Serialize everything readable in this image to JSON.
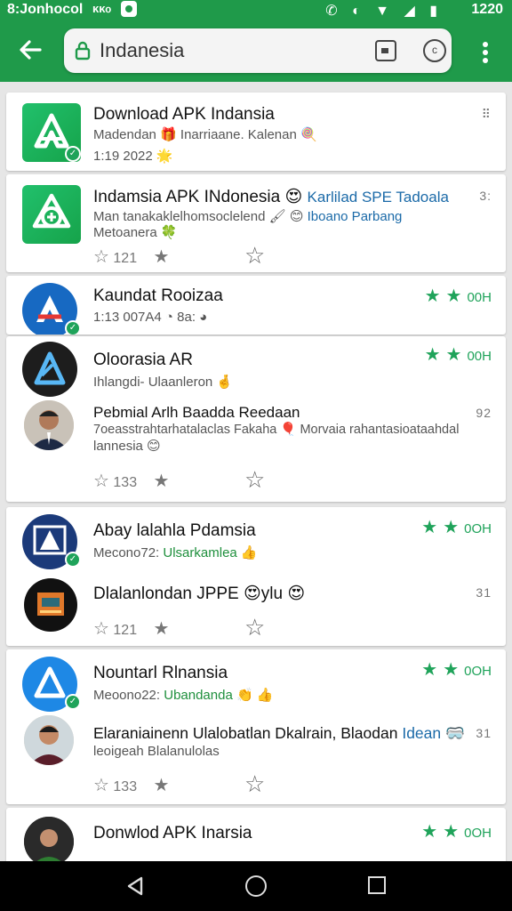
{
  "status_bar": {
    "carrier": "8:Jonhocol",
    "net": "ᴋᴋ᧐",
    "icons": "✆ ◐ ▼ ◢ ▮",
    "time": "1220"
  },
  "toolbar": {
    "search_query": "Indanesia"
  },
  "results": [
    {
      "title": "Download APK  Indansia",
      "subtitle": "Madendan 🎁 Inarriaane. Kalenan 🍭",
      "meta": "1:19  2022 🌟",
      "menu": "⠿"
    },
    {
      "title": "Indamsia APK INdonesia 😍",
      "title_link": "Karlilad SPE Tadoala",
      "subtitle": "Man tanakaklelhomsoclelend 🖌 😊",
      "subtitle_link": "Iboano Parbang",
      "subtitle2": "Metoanera 🍀",
      "rating": "121",
      "menu": "3:"
    },
    {
      "title": "Kaundat Rooizaa",
      "meta": "1:13  007A4  ◔ 8a: ◕",
      "count": "00H"
    },
    {
      "title": "Oloorasia AR",
      "subtitle": "Ihlangdi- Ulaanleron 🤞",
      "count": "00H"
    },
    {
      "title": "Pebmial Arlh Baadda Reedaan",
      "subtitle": "7oeasstrahtarhatalaclas Fakaha 🎈 Morvaia rahantasioataahdal",
      "subtitle2": "lannesia 😊",
      "rating": "133",
      "menu": "92"
    },
    {
      "title": "Abay lalahla Pdamsia",
      "subtitle": "Mecono72:",
      "subtitle_link": "Ulsarkamlea 👍",
      "count": "0OH"
    },
    {
      "title": "Dlalanlondan JPPE 😍ylu 😍",
      "rating": "121",
      "menu": "31"
    },
    {
      "title": "Nountarl Rlnansia",
      "subtitle": "Meoono22:",
      "subtitle_link": "Ubandanda 👏   👍",
      "count": "0OH"
    },
    {
      "title": "Elaraniainenn Ulalobatlan Dkalrain, Blaodan",
      "title_link": "Idean 🥽",
      "subtitle": "leoigeah Blalanulolas",
      "rating": "133",
      "menu": "31"
    },
    {
      "title": "Donwlod APK Inarsia",
      "count": "0OH"
    }
  ]
}
